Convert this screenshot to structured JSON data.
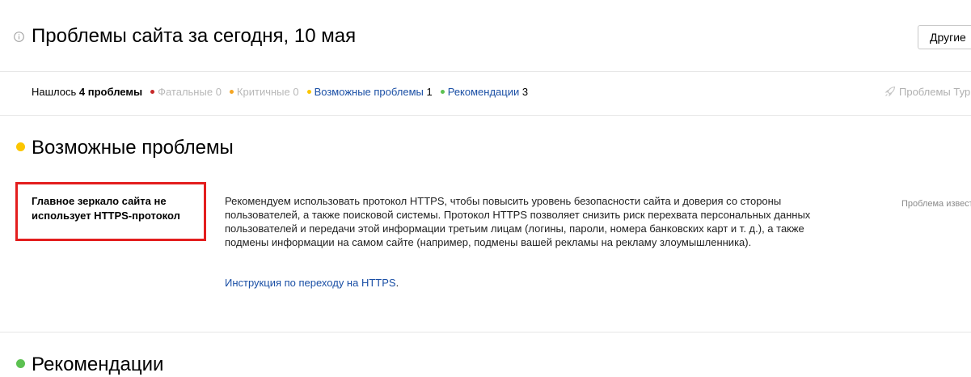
{
  "header": {
    "title": "Проблемы сайта за сегодня, 10 мая",
    "other_button": "Другие"
  },
  "summary": {
    "found_prefix": "Нашлось",
    "found_count": "4 проблемы",
    "fatal_label": "Фатальные",
    "fatal_count": "0",
    "critical_label": "Критичные",
    "critical_count": "0",
    "possible_label": "Возможные проблемы",
    "possible_count": "1",
    "recommendations_label": "Рекомендации",
    "recommendations_count": "3",
    "turbo_label": "Проблемы Тур"
  },
  "sections": {
    "possible": {
      "title": "Возможные проблемы",
      "problem_name": "Главное зеркало сайта не использует HTTPS-протокол",
      "description": "Рекомендуем использовать протокол HTTPS, чтобы повысить уровень безопасности сайта и доверия со стороны пользователей, а также поисковой системы. Протокол HTTPS позволяет снизить риск перехвата персональных данных пользователей и передачи этой информации третьим лицам (логины, пароли, номера банковских карт и т. д.), а также подмены информации на самом сайте (например, подмены вашей рекламы на рекламу злоумышленника).",
      "link_text": "Инструкция по переходу на HTTPS",
      "link_suffix": ".",
      "status": "Проблема извест"
    },
    "recommendations": {
      "title": "Рекомендации"
    }
  },
  "colors": {
    "fatal": "#c62828",
    "critical": "#f5a623",
    "possible": "#fcc600",
    "recommendation": "#5cc151",
    "highlight": "#e31e1e",
    "link": "#1a4fa5"
  },
  "icons": {
    "title": "info-icon",
    "turbo": "rocket-icon"
  }
}
